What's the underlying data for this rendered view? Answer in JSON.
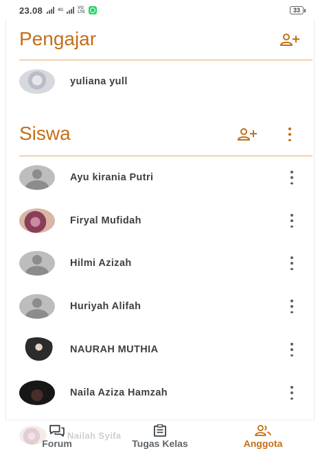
{
  "status_bar": {
    "time": "23.08",
    "network_label": "4G",
    "volte_label_top": "VO",
    "volte_label_bottom": "LTE",
    "battery": "33",
    "icons": [
      "signal-icon",
      "signal-icon",
      "volte-icon",
      "whatsapp-icon",
      "battery-icon"
    ]
  },
  "teachers": {
    "title": "Pengajar",
    "add_icon": "add-person-icon",
    "members": [
      {
        "name": "yuliana yull",
        "avatar": "photo"
      }
    ]
  },
  "students": {
    "title": "Siswa",
    "add_icon": "add-person-icon",
    "more_icon": "more-vert-icon",
    "members": [
      {
        "name": "Ayu kirania Putri",
        "avatar": "default"
      },
      {
        "name": "Firyal Mufidah",
        "avatar": "photo"
      },
      {
        "name": "Hilmi Azizah",
        "avatar": "default"
      },
      {
        "name": "Huriyah Alifah",
        "avatar": "default"
      },
      {
        "name": "NAURAH MUTHIA",
        "avatar": "photo"
      },
      {
        "name": "Naila Aziza Hamzah",
        "avatar": "photo"
      },
      {
        "name": "Nailah Syifa",
        "avatar": "photo"
      }
    ]
  },
  "bottom_nav": {
    "items": [
      {
        "label": "Forum",
        "icon": "forum-icon",
        "active": false
      },
      {
        "label": "Tugas Kelas",
        "icon": "assignment-icon",
        "active": false
      },
      {
        "label": "Anggota",
        "icon": "people-icon",
        "active": true
      }
    ]
  },
  "colors": {
    "accent": "#c46e16",
    "divider": "#e8a860",
    "text": "#3c4043",
    "icon_grey": "#5f6368"
  }
}
